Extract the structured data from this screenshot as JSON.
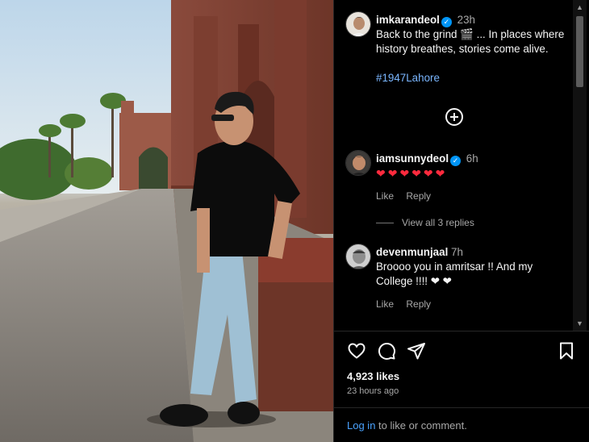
{
  "post": {
    "author": "imkarandeol",
    "time": "23h",
    "caption": "Back to the grind 🎬 ... In places where history breathes, stories come alive.",
    "hashtag": "#1947Lahore"
  },
  "comments": [
    {
      "author": "iamsunnydeol",
      "time": "6h",
      "text": "❤❤❤❤❤❤",
      "like_label": "Like",
      "reply_label": "Reply",
      "view_replies": "View all 3 replies"
    },
    {
      "author": "devenmunjaal",
      "time": "7h",
      "text": "Broooo you in amritsar !! And my College !!!! ❤ ❤",
      "like_label": "Like",
      "reply_label": "Reply"
    }
  ],
  "stats": {
    "likes": "4,923 likes",
    "posted_ago": "23 hours ago"
  },
  "footer": {
    "login_link": "Log in",
    "login_suffix": " to like or comment."
  },
  "icons": {
    "verified": "verified-badge-icon",
    "add_comment": "plus-circle-icon",
    "like": "heart-icon",
    "comment": "comment-bubble-icon",
    "share": "paper-plane-icon",
    "save": "bookmark-icon"
  },
  "colors": {
    "accent": "#0095f6",
    "link": "#4aa3ff",
    "heart": "#ff2a3d",
    "hashtag": "#7ab6ff"
  }
}
